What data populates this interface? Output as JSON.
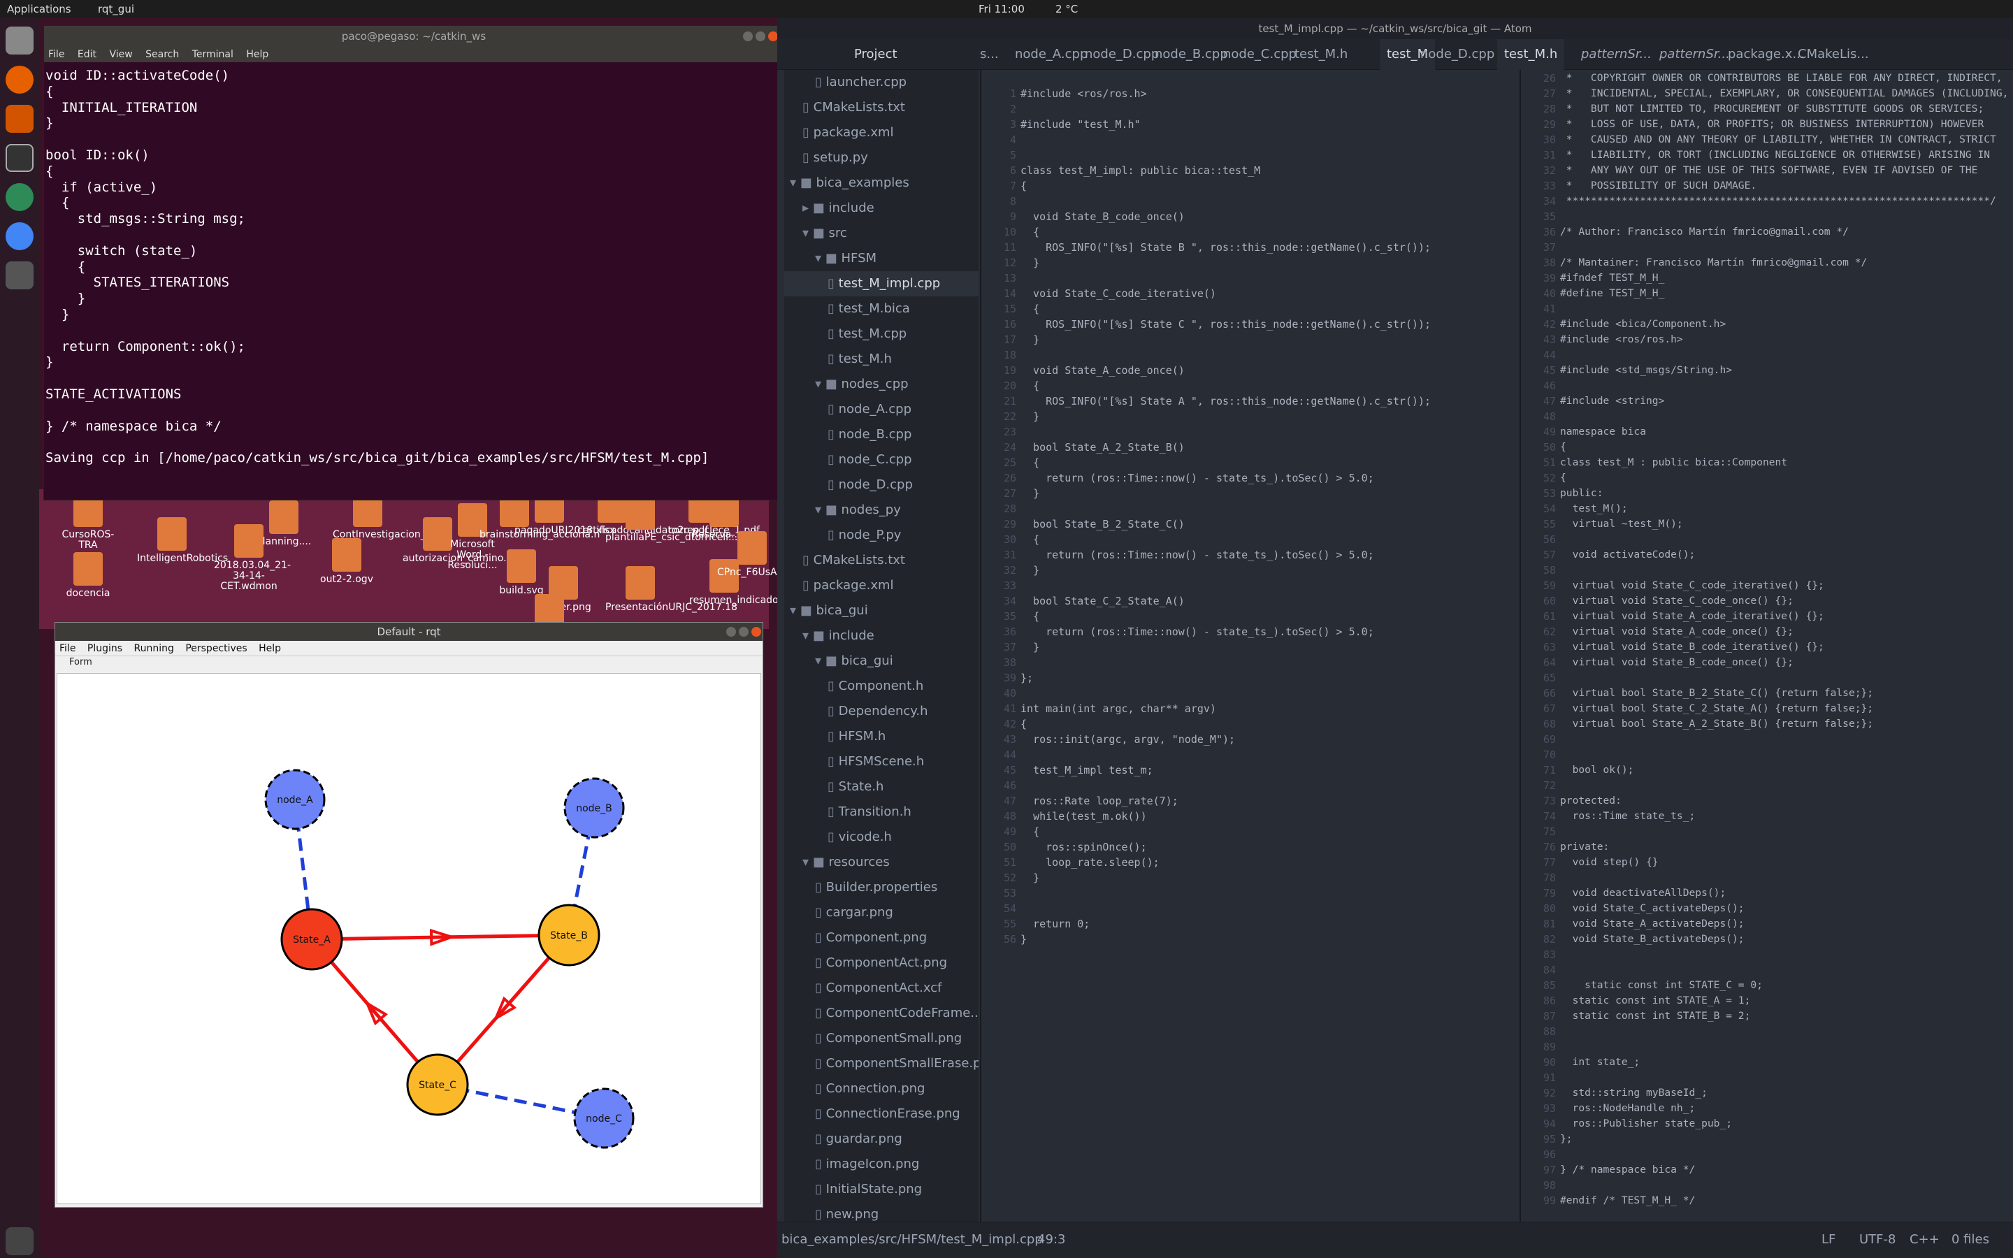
{
  "topbar": {
    "apps": "Applications",
    "rqt": "rqt_gui",
    "clock": "Fri 11:00",
    "temp": "2 °C"
  },
  "terminal": {
    "title": "paco@pegaso: ~/catkin_ws",
    "menu": [
      "File",
      "Edit",
      "View",
      "Search",
      "Terminal",
      "Help"
    ],
    "text": "void ID::activateCode()\n{\n  INITIAL_ITERATION\n}\n\nbool ID::ok()\n{\n  if (active_)\n  {\n    std_msgs::String msg;\n\n    switch (state_)\n    {\n      STATES_ITERATIONS\n    }\n  }\n\n  return Component::ok();\n}\n\nSTATE_ACTIVATIONS\n\n} /* namespace bica */\n\nSaving ccp in [/home/paco/catkin_ws/src/bica_git/bica_examples/src/HFSM/test_M.cpp]"
  },
  "desktop_icons": [
    "CursoROS-TRA",
    "planning....",
    "ContInvestigacion_2...",
    "IntelligentRobotics",
    "2018.03.04_21-34-14-CET.wdmon",
    "out2-2.ogv",
    "autorizacion_camino.pages",
    "Microsoft Word - Resoluci...",
    "brainstorming_acciona.n",
    "build.svg",
    "pepper.png",
    "pagadoURJ2018.xlsx",
    "certificadocandidato2c.pdf",
    "plantillaPE_csic_dtorricell...",
    "correo_clece_1.pdf",
    "Reserva...pdf",
    "docencia",
    "PresentaciónURJC_2017.18",
    "resumen_indicadores_CIT.pdf",
    "CPnc_F6UsAAWaxb.png",
    "Pepper1..."
  ],
  "rqt": {
    "title": "Default - rqt",
    "menu": [
      "File",
      "Plugins",
      "Running",
      "Perspectives",
      "Help"
    ],
    "form": "Form",
    "nodes": [
      {
        "label": "node_A",
        "kind": "node"
      },
      {
        "label": "node_B",
        "kind": "node"
      },
      {
        "label": "State_A",
        "kind": "active"
      },
      {
        "label": "State_B",
        "kind": "state"
      },
      {
        "label": "State_C",
        "kind": "state"
      },
      {
        "label": "node_C",
        "kind": "node"
      }
    ],
    "colors": {
      "node": "#6c84f7",
      "active": "#f23b1c",
      "state": "#fbb829",
      "transition": "#ee1111",
      "dependency": "#1f3fd8"
    }
  },
  "atom": {
    "title": "test_M_impl.cpp — ~/catkin_ws/src/bica_git — Atom",
    "project_label": "Project",
    "tabs": [
      "s...",
      "node_A.cpp",
      "node_D.cpp",
      "node_B.cpp",
      "node_C.cpp",
      "test_M.h",
      "test_M",
      "node_D.cpp",
      "test_M.h",
      "patternSr...",
      "patternSr...",
      "package.x...",
      "CMakeLis..."
    ],
    "tree": [
      {
        "label": "launcher.cpp",
        "depth": 2,
        "type": "file"
      },
      {
        "label": "CMakeLists.txt",
        "depth": 1,
        "type": "file"
      },
      {
        "label": "package.xml",
        "depth": 1,
        "type": "file"
      },
      {
        "label": "setup.py",
        "depth": 1,
        "type": "file"
      },
      {
        "label": "bica_examples",
        "depth": 0,
        "type": "dir-open"
      },
      {
        "label": "include",
        "depth": 1,
        "type": "dir"
      },
      {
        "label": "src",
        "depth": 1,
        "type": "dir-open"
      },
      {
        "label": "HFSM",
        "depth": 2,
        "type": "dir-open"
      },
      {
        "label": "test_M_impl.cpp",
        "depth": 3,
        "type": "file",
        "selected": true
      },
      {
        "label": "test_M.bica",
        "depth": 3,
        "type": "file"
      },
      {
        "label": "test_M.cpp",
        "depth": 3,
        "type": "file"
      },
      {
        "label": "test_M.h",
        "depth": 3,
        "type": "file"
      },
      {
        "label": "nodes_cpp",
        "depth": 2,
        "type": "dir-open"
      },
      {
        "label": "node_A.cpp",
        "depth": 3,
        "type": "file"
      },
      {
        "label": "node_B.cpp",
        "depth": 3,
        "type": "file"
      },
      {
        "label": "node_C.cpp",
        "depth": 3,
        "type": "file"
      },
      {
        "label": "node_D.cpp",
        "depth": 3,
        "type": "file"
      },
      {
        "label": "nodes_py",
        "depth": 2,
        "type": "dir-open"
      },
      {
        "label": "node_P.py",
        "depth": 3,
        "type": "file"
      },
      {
        "label": "CMakeLists.txt",
        "depth": 1,
        "type": "file"
      },
      {
        "label": "package.xml",
        "depth": 1,
        "type": "file"
      },
      {
        "label": "bica_gui",
        "depth": 0,
        "type": "dir-open"
      },
      {
        "label": "include",
        "depth": 1,
        "type": "dir-open"
      },
      {
        "label": "bica_gui",
        "depth": 2,
        "type": "dir-open"
      },
      {
        "label": "Component.h",
        "depth": 3,
        "type": "file"
      },
      {
        "label": "Dependency.h",
        "depth": 3,
        "type": "file"
      },
      {
        "label": "HFSM.h",
        "depth": 3,
        "type": "file"
      },
      {
        "label": "HFSMScene.h",
        "depth": 3,
        "type": "file"
      },
      {
        "label": "State.h",
        "depth": 3,
        "type": "file"
      },
      {
        "label": "Transition.h",
        "depth": 3,
        "type": "file"
      },
      {
        "label": "vicode.h",
        "depth": 3,
        "type": "file"
      },
      {
        "label": "resources",
        "depth": 1,
        "type": "dir-open"
      },
      {
        "label": "Builder.properties",
        "depth": 2,
        "type": "file"
      },
      {
        "label": "cargar.png",
        "depth": 2,
        "type": "file"
      },
      {
        "label": "Component.png",
        "depth": 2,
        "type": "file"
      },
      {
        "label": "ComponentAct.png",
        "depth": 2,
        "type": "file"
      },
      {
        "label": "ComponentAct.xcf",
        "depth": 2,
        "type": "file"
      },
      {
        "label": "ComponentCodeFrame...",
        "depth": 2,
        "type": "file"
      },
      {
        "label": "ComponentSmall.png",
        "depth": 2,
        "type": "file"
      },
      {
        "label": "ComponentSmallErase.p",
        "depth": 2,
        "type": "file"
      },
      {
        "label": "Connection.png",
        "depth": 2,
        "type": "file"
      },
      {
        "label": "ConnectionErase.png",
        "depth": 2,
        "type": "file"
      },
      {
        "label": "guardar.png",
        "depth": 2,
        "type": "file"
      },
      {
        "label": "imageIcon.png",
        "depth": 2,
        "type": "file"
      },
      {
        "label": "InitialState.png",
        "depth": 2,
        "type": "file"
      },
      {
        "label": "new.png",
        "depth": 2,
        "type": "file"
      }
    ],
    "left_editor": {
      "first_line": 1,
      "text": "#include <ros/ros.h>\n\n#include \"test_M.h\"\n\n\nclass test_M_impl: public bica::test_M\n{\n\n  void State_B_code_once()\n  {\n    ROS_INFO(\"[%s] State B \", ros::this_node::getName().c_str());\n  }\n\n  void State_C_code_iterative()\n  {\n    ROS_INFO(\"[%s] State C \", ros::this_node::getName().c_str());\n  }\n\n  void State_A_code_once()\n  {\n    ROS_INFO(\"[%s] State A \", ros::this_node::getName().c_str());\n  }\n\n  bool State_A_2_State_B()\n  {\n    return (ros::Time::now() - state_ts_).toSec() > 5.0;\n  }\n\n  bool State_B_2_State_C()\n  {\n    return (ros::Time::now() - state_ts_).toSec() > 5.0;\n  }\n\n  bool State_C_2_State_A()\n  {\n    return (ros::Time::now() - state_ts_).toSec() > 5.0;\n  }\n\n};\n\nint main(int argc, char** argv)\n{\n  ros::init(argc, argv, \"node_M\");\n\n  test_M_impl test_m;\n\n  ros::Rate loop_rate(7);\n  while(test_m.ok())\n  {\n    ros::spinOnce();\n    loop_rate.sleep();\n  }\n\n\n  return 0;\n}"
    },
    "right_editor": {
      "first_line": 26,
      "text": " *   COPYRIGHT OWNER OR CONTRIBUTORS BE LIABLE FOR ANY DIRECT, INDIRECT,\n *   INCIDENTAL, SPECIAL, EXEMPLARY, OR CONSEQUENTIAL DAMAGES (INCLUDING,\n *   BUT NOT LIMITED TO, PROCUREMENT OF SUBSTITUTE GOODS OR SERVICES;\n *   LOSS OF USE, DATA, OR PROFITS; OR BUSINESS INTERRUPTION) HOWEVER\n *   CAUSED AND ON ANY THEORY OF LIABILITY, WHETHER IN CONTRACT, STRICT\n *   LIABILITY, OR TORT (INCLUDING NEGLIGENCE OR OTHERWISE) ARISING IN\n *   ANY WAY OUT OF THE USE OF THIS SOFTWARE, EVEN IF ADVISED OF THE\n *   POSSIBILITY OF SUCH DAMAGE.\n *********************************************************************/\n\n/* Author: Francisco Martín fmrico@gmail.com */\n\n/* Mantainer: Francisco Martín fmrico@gmail.com */\n#ifndef TEST_M_H_\n#define TEST_M_H_\n\n#include <bica/Component.h>\n#include <ros/ros.h>\n\n#include <std_msgs/String.h>\n\n#include <string>\n\nnamespace bica\n{\nclass test_M : public bica::Component\n{\npublic:\n  test_M();\n  virtual ~test_M();\n\n  void activateCode();\n\n  virtual void State_C_code_iterative() {};\n  virtual void State_C_code_once() {};\n  virtual void State_A_code_iterative() {};\n  virtual void State_A_code_once() {};\n  virtual void State_B_code_iterative() {};\n  virtual void State_B_code_once() {};\n\n  virtual bool State_B_2_State_C() {return false;};\n  virtual bool State_C_2_State_A() {return false;};\n  virtual bool State_A_2_State_B() {return false;};\n\n\n  bool ok();\n\nprotected:\n  ros::Time state_ts_;\n\nprivate:\n  void step() {}\n\n  void deactivateAllDeps();\n  void State_C_activateDeps();\n  void State_A_activateDeps();\n  void State_B_activateDeps();\n\n\n    static const int STATE_C = 0;\n  static const int STATE_A = 1;\n  static const int STATE_B = 2;\n\n\n  int state_;\n\n  std::string myBaseId_;\n  ros::NodeHandle nh_;\n  ros::Publisher state_pub_;\n};\n\n} /* namespace bica */\n\n#endif /* TEST_M_H_ */"
    },
    "status": {
      "path": "bica_examples/src/HFSM/test_M_impl.cpp",
      "cursor": "49:3",
      "eol": "LF",
      "encoding": "UTF-8",
      "grammar": "C++",
      "git": "0 files"
    }
  }
}
